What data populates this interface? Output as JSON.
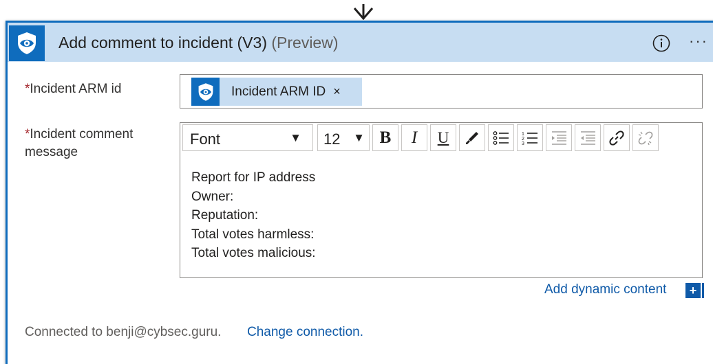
{
  "action": {
    "title": "Add comment to incident (V3)",
    "title_suffix": "(Preview)",
    "icon": "shield-eye-icon",
    "more_label": "···"
  },
  "fields": {
    "arm_id": {
      "required_mark": "*",
      "label": "Incident ARM id",
      "token_label": "Incident ARM ID",
      "token_remove": "×"
    },
    "comment": {
      "required_mark": "*",
      "label_line1": "Incident comment",
      "label_line2": "message",
      "toolbar": {
        "font": "Font",
        "size": "12",
        "bold": "B",
        "italic": "I",
        "underline": "U",
        "buttons": [
          "bold",
          "italic",
          "underline",
          "font-color",
          "bulleted-list",
          "numbered-list",
          "increase-indent",
          "decrease-indent",
          "link",
          "unlink"
        ]
      },
      "lines": [
        "Report for IP address",
        "Owner:",
        "Reputation:",
        "Total votes harmless:",
        "Total votes malicious:"
      ]
    }
  },
  "dynamic_content": {
    "label": "Add dynamic content",
    "plus": "+"
  },
  "connection": {
    "text": "Connected to benji@cybsec.guru.",
    "change_link": "Change connection."
  },
  "colors": {
    "accent": "#0f6cbd",
    "header_bg": "#c7ddf2",
    "link": "#0f5aa8",
    "required": "#a4262c"
  }
}
